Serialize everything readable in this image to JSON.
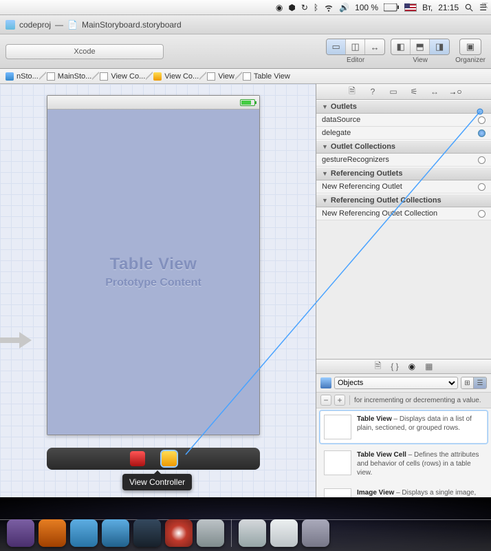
{
  "menubar": {
    "battery_text": "100 %",
    "day": "Вт,",
    "time": "21:15"
  },
  "titlebar": {
    "project": "codeproj",
    "file": "MainStoryboard.storyboard"
  },
  "toolbar": {
    "scheme": "Xcode",
    "editor_label": "Editor",
    "view_label": "View",
    "organizer_label": "Organizer"
  },
  "jumpbar": {
    "crumbs": [
      "nSto...",
      "MainSto...",
      "View Co...",
      "View Co...",
      "View",
      "Table View"
    ]
  },
  "canvas": {
    "tv_title": "Table View",
    "tv_sub": "Prototype Content",
    "tooltip": "View Controller"
  },
  "inspector": {
    "sections": {
      "outlets": "Outlets",
      "outlet_collections": "Outlet Collections",
      "ref_outlets": "Referencing Outlets",
      "ref_outlet_coll": "Referencing Outlet Collections"
    },
    "rows": {
      "dataSource": "dataSource",
      "delegate": "delegate",
      "gesture": "gestureRecognizers",
      "new_ref": "New Referencing Outlet",
      "new_ref_coll": "New Referencing Outlet Collection"
    }
  },
  "library": {
    "filter_label": "Objects",
    "items": [
      {
        "title": "",
        "desc": "for incrementing or decrementing a value."
      },
      {
        "title": "Table View",
        "desc": " – Displays data in a list of plain, sectioned, or grouped rows."
      },
      {
        "title": "Table View Cell",
        "desc": " – Defines the attributes and behavior of cells (rows) in a table view."
      },
      {
        "title": "Image View",
        "desc": " – Displays a single image, or an animation described by"
      }
    ],
    "search_placeholder": ""
  }
}
